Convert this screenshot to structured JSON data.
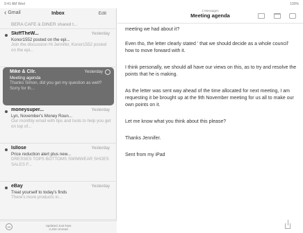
{
  "status": {
    "time": "9:41 AM Wed",
    "battery": "100%"
  },
  "sidebar": {
    "back_label": "Gmail",
    "title": "Inbox",
    "edit_label": "Edit",
    "cut_row": "BERA CAFE & DINER shared t...",
    "messages": [
      {
        "sender": "SkiffTheW...",
        "date": "Yesterday",
        "subject": "Konor1552 posted on the epi...",
        "preview": "Join the discussion Hi Jennifer, Konor1552 posted on the epi..."
      },
      {
        "sender": "Mike & Cllr.",
        "date": "Yesterday",
        "subject": "Meeting agenda",
        "preview": "Thanks Simon, did you get my question as well? Sorry for th..."
      },
      {
        "sender": "moneysuper...",
        "date": "Yesterday",
        "subject": "Lyn, November's Money Roun...",
        "preview": "Our monthly email with tips and tools to help you get on top of..."
      },
      {
        "sender": "Isllose",
        "date": "Yesterday",
        "subject": "Price reduction alert plus new...",
        "preview": "DRESSES TOPS BOTTOMS SWIMWEAR SHOES SALES F..."
      },
      {
        "sender": "eBay",
        "date": "Yesterday",
        "subject": "Treat yourself to today's finds",
        "preview": "There's more products in..."
      }
    ],
    "footer_line1": "Updated Just Now",
    "footer_line2": "2,402 Unread"
  },
  "main": {
    "count": "2 Messages",
    "title": "Meeting agenda",
    "paragraphs": [
      "meeting we had about it?",
      "Even tho, the letter clearly stated ' that we should decide as a whole council' how to move forward with it.",
      "I think personally, we should all have our views on this, as to try and resolve the points that he is making.",
      "As the letter was sent way ahead of the time allocated for next meeting, I am requesting it be brought up at the 9th November meeting for us all to make our own points on it.",
      "Let me know what you think about this please?",
      "Thanks Jennifer.",
      "Sent from my iPad"
    ]
  }
}
